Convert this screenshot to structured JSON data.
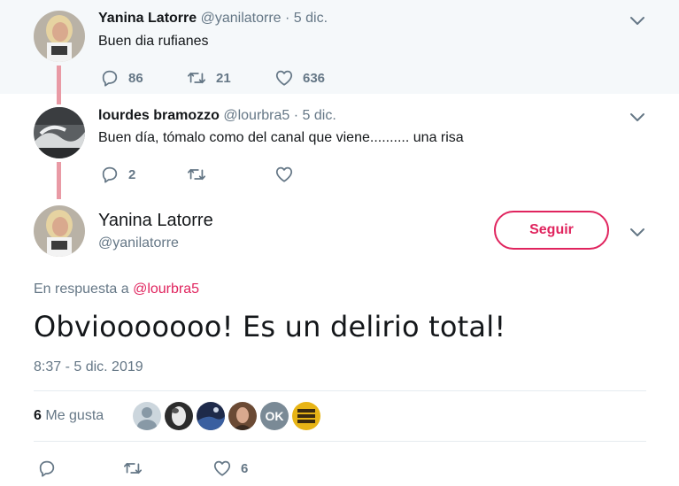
{
  "tweets": [
    {
      "name": "Yanina Latorre",
      "handle": "@yanilatorre",
      "date": "5 dic.",
      "text": "Buen dia rufianes",
      "replies": "86",
      "retweets": "21",
      "likes": "636"
    },
    {
      "name": "lourdes bramozzo",
      "handle": "@lourbra5",
      "date": "5 dic.",
      "text": "Buen día, tómalo como del canal que viene.......... una risa",
      "replies": "2",
      "retweets": "",
      "likes": ""
    }
  ],
  "separator": "·",
  "main": {
    "name": "Yanina Latorre",
    "handle": "@yanilatorre",
    "follow_label": "Seguir",
    "reply_prefix": "En respuesta a",
    "reply_mention": "@lourbra5",
    "text": "Obviooooooo! Es un delirio total!",
    "timestamp": "8:37 - 5 dic. 2019",
    "like_count": "6",
    "like_label": "Me gusta",
    "likers_avatar_text": "OK",
    "action_likes": "6"
  },
  "icons": [
    "reply-icon",
    "retweet-icon",
    "heart-icon",
    "chevron-down-icon"
  ],
  "colors": {
    "accent": "#e0245e",
    "thread": "#e99aa5",
    "muted": "#657786"
  }
}
